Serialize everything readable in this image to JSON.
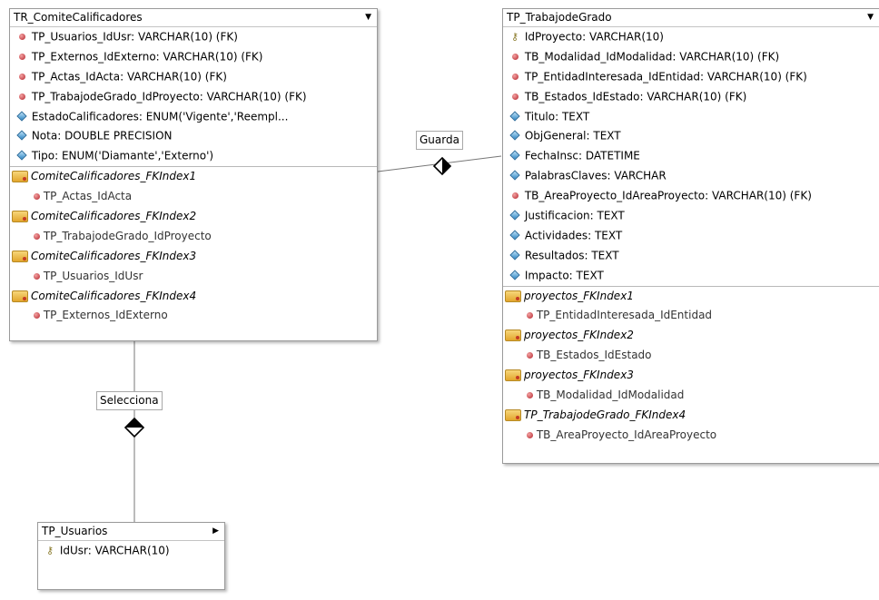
{
  "entities": {
    "comite": {
      "title": "TR_ComiteCalificadores",
      "columns": [
        {
          "icon": "fk-icon",
          "text": "TP_Usuarios_IdUsr: VARCHAR(10) (FK)"
        },
        {
          "icon": "fk-icon",
          "text": "TP_Externos_IdExterno: VARCHAR(10) (FK)"
        },
        {
          "icon": "fk-icon",
          "text": "TP_Actas_IdActa: VARCHAR(10) (FK)"
        },
        {
          "icon": "fk-icon",
          "text": "TP_TrabajodeGrado_IdProyecto: VARCHAR(10) (FK)"
        },
        {
          "icon": "attribute-icon",
          "text": "EstadoCalificadores: ENUM('Vigente','Reempl..."
        },
        {
          "icon": "attribute-icon",
          "text": "Nota: DOUBLE PRECISION"
        },
        {
          "icon": "attribute-icon",
          "text": "Tipo: ENUM('Diamante','Externo')"
        }
      ],
      "indexes": [
        {
          "name": "ComiteCalificadores_FKIndex1",
          "column": "TP_Actas_IdActa"
        },
        {
          "name": "ComiteCalificadores_FKIndex2",
          "column": "TP_TrabajodeGrado_IdProyecto"
        },
        {
          "name": "ComiteCalificadores_FKIndex3",
          "column": "TP_Usuarios_IdUsr"
        },
        {
          "name": "ComiteCalificadores_FKIndex4",
          "column": "TP_Externos_IdExterno"
        }
      ]
    },
    "trabajo": {
      "title": "TP_TrabajodeGrado",
      "columns": [
        {
          "icon": "key-icon",
          "text": "IdProyecto: VARCHAR(10)"
        },
        {
          "icon": "fk-icon",
          "text": "TB_Modalidad_IdModalidad: VARCHAR(10) (FK)"
        },
        {
          "icon": "fk-icon",
          "text": "TP_EntidadInteresada_IdEntidad: VARCHAR(10) (FK)"
        },
        {
          "icon": "fk-icon",
          "text": "TB_Estados_IdEstado: VARCHAR(10) (FK)"
        },
        {
          "icon": "attribute-icon",
          "text": "Titulo: TEXT"
        },
        {
          "icon": "attribute-icon",
          "text": "ObjGeneral: TEXT"
        },
        {
          "icon": "attribute-icon",
          "text": "FechaInsc: DATETIME"
        },
        {
          "icon": "attribute-icon",
          "text": "PalabrasClaves: VARCHAR"
        },
        {
          "icon": "fk-icon",
          "text": "TB_AreaProyecto_IdAreaProyecto: VARCHAR(10) (FK)"
        },
        {
          "icon": "attribute-icon",
          "text": "Justificacion: TEXT"
        },
        {
          "icon": "attribute-icon",
          "text": "Actividades: TEXT"
        },
        {
          "icon": "attribute-icon",
          "text": "Resultados: TEXT"
        },
        {
          "icon": "attribute-icon",
          "text": "Impacto: TEXT"
        }
      ],
      "indexes": [
        {
          "name": "proyectos_FKIndex1",
          "column": "TP_EntidadInteresada_IdEntidad"
        },
        {
          "name": "proyectos_FKIndex2",
          "column": "TB_Estados_IdEstado"
        },
        {
          "name": "proyectos_FKIndex3",
          "column": "TB_Modalidad_IdModalidad"
        },
        {
          "name": "TP_TrabajodeGrado_FKIndex4",
          "column": "TB_AreaProyecto_IdAreaProyecto"
        }
      ]
    },
    "usuarios": {
      "title": "TP_Usuarios",
      "columns": [
        {
          "icon": "key-icon",
          "text": "IdUsr: VARCHAR(10)"
        }
      ]
    }
  },
  "relationships": {
    "guarda": "Guarda",
    "selecciona": "Selecciona"
  }
}
